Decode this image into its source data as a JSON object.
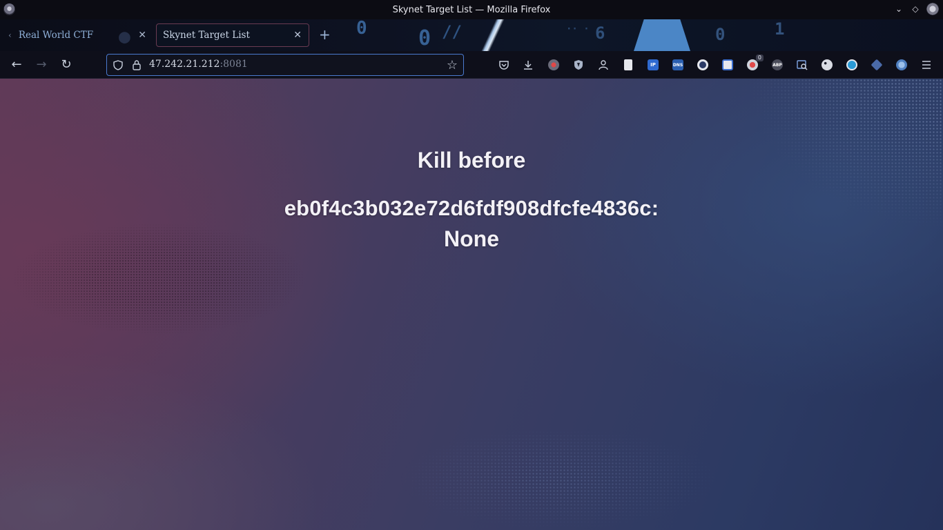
{
  "window": {
    "title": "Skynet Target List — Mozilla Firefox"
  },
  "tabs": [
    {
      "label": "Real World CTF",
      "active": false
    },
    {
      "label": "Skynet Target List",
      "active": true
    }
  ],
  "address_bar": {
    "host": "47.242.21.212",
    "port": ":8081"
  },
  "extensions": [
    {
      "icon": "pocket-icon"
    },
    {
      "icon": "downloads-icon"
    },
    {
      "icon": "extension-red-dot-icon"
    },
    {
      "icon": "shield-extension-icon"
    },
    {
      "icon": "user-switch-icon"
    },
    {
      "icon": "document-icon"
    },
    {
      "icon": "ip-extension-icon",
      "label": "IP"
    },
    {
      "icon": "dns-extension-icon",
      "label": "DNS"
    },
    {
      "icon": "circle-extension-icon"
    },
    {
      "icon": "save-extension-icon"
    },
    {
      "icon": "extension-badge-icon",
      "badge": "0"
    },
    {
      "icon": "adblock-plus-icon",
      "label": "ABP"
    },
    {
      "icon": "search-page-icon"
    },
    {
      "icon": "cookie-icon"
    },
    {
      "icon": "grammar-extension-icon"
    },
    {
      "icon": "diamond-extension-icon"
    },
    {
      "icon": "globe-icon"
    },
    {
      "icon": "menu-icon"
    }
  ],
  "page": {
    "heading": "Kill before",
    "target_id": "eb0f4c3b032e72d6fdf908dfcfe4836c:",
    "target_value": "None"
  },
  "colors": {
    "urlbar_border": "#4b7bd0",
    "active_tab_border": "#6a3b52",
    "page_gradient_left": "#5d3a58",
    "page_gradient_right": "#25325a"
  }
}
